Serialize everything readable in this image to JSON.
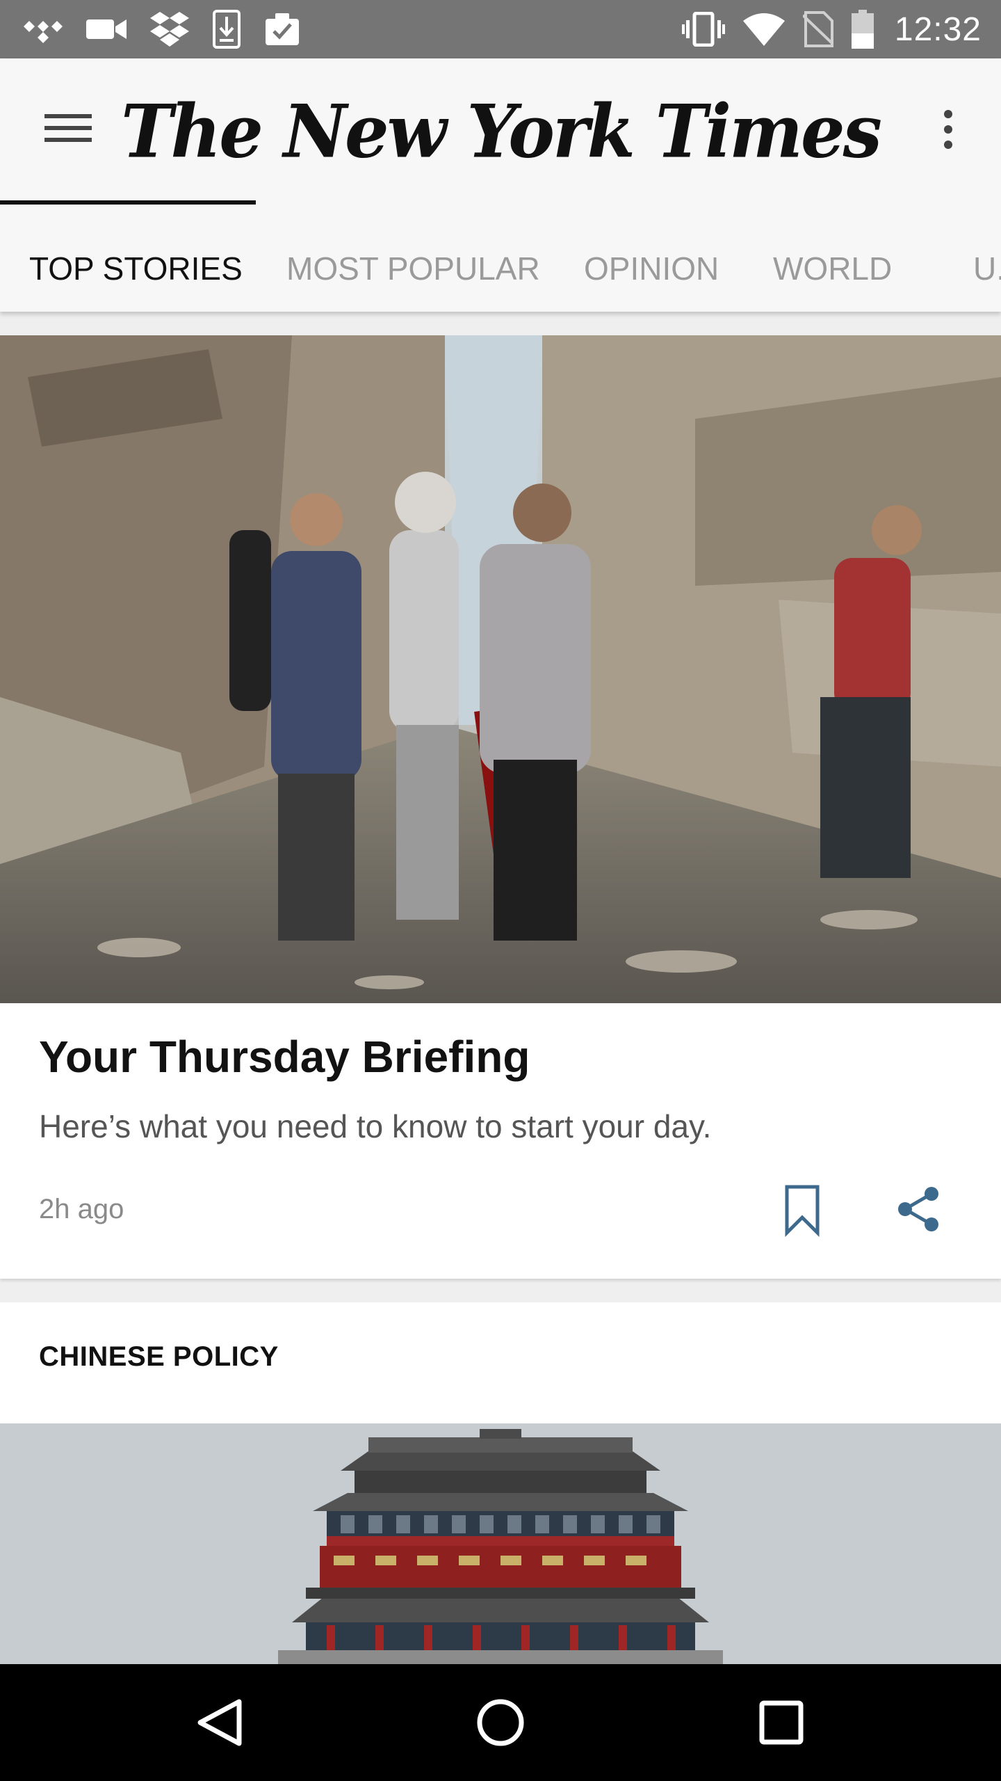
{
  "status_bar": {
    "time": "12:32",
    "left_icons": [
      "tidal-icon",
      "video-camera-icon",
      "dropbox-icon",
      "download-icon",
      "clipboard-check-icon"
    ],
    "right_icons": [
      "vibrate-icon",
      "wifi-icon",
      "no-sim-icon",
      "battery-icon"
    ]
  },
  "app_bar": {
    "masthead": "The New York Times",
    "menu_icon": "hamburger-menu-icon",
    "overflow_icon": "more-vert-icon"
  },
  "tabs": [
    {
      "label": "TOP STORIES",
      "active": true
    },
    {
      "label": "MOST POPULAR",
      "active": false
    },
    {
      "label": "OPINION",
      "active": false
    },
    {
      "label": "WORLD",
      "active": false
    },
    {
      "label": "U.",
      "active": false
    }
  ],
  "lead_story": {
    "headline": "Your Thursday Briefing",
    "summary": "Here’s what you need to know to start your day.",
    "timestamp": "2h ago",
    "image_icon": "photo-syria-rubble",
    "save_icon": "bookmark-icon",
    "share_icon": "share-icon"
  },
  "next_section": {
    "label": "CHINESE POLICY",
    "image_icon": "photo-chinese-gate-tower"
  },
  "nav_bar": {
    "back_icon": "back-triangle-icon",
    "home_icon": "home-circle-icon",
    "recents_icon": "recents-square-icon"
  },
  "colors": {
    "status_bar": "#757575",
    "app_bar": "#f7f7f7",
    "active_tab": "#111111",
    "inactive_tab": "#9a9a9a",
    "action_icon": "#3d6a8c",
    "nav_bar": "#000000"
  }
}
